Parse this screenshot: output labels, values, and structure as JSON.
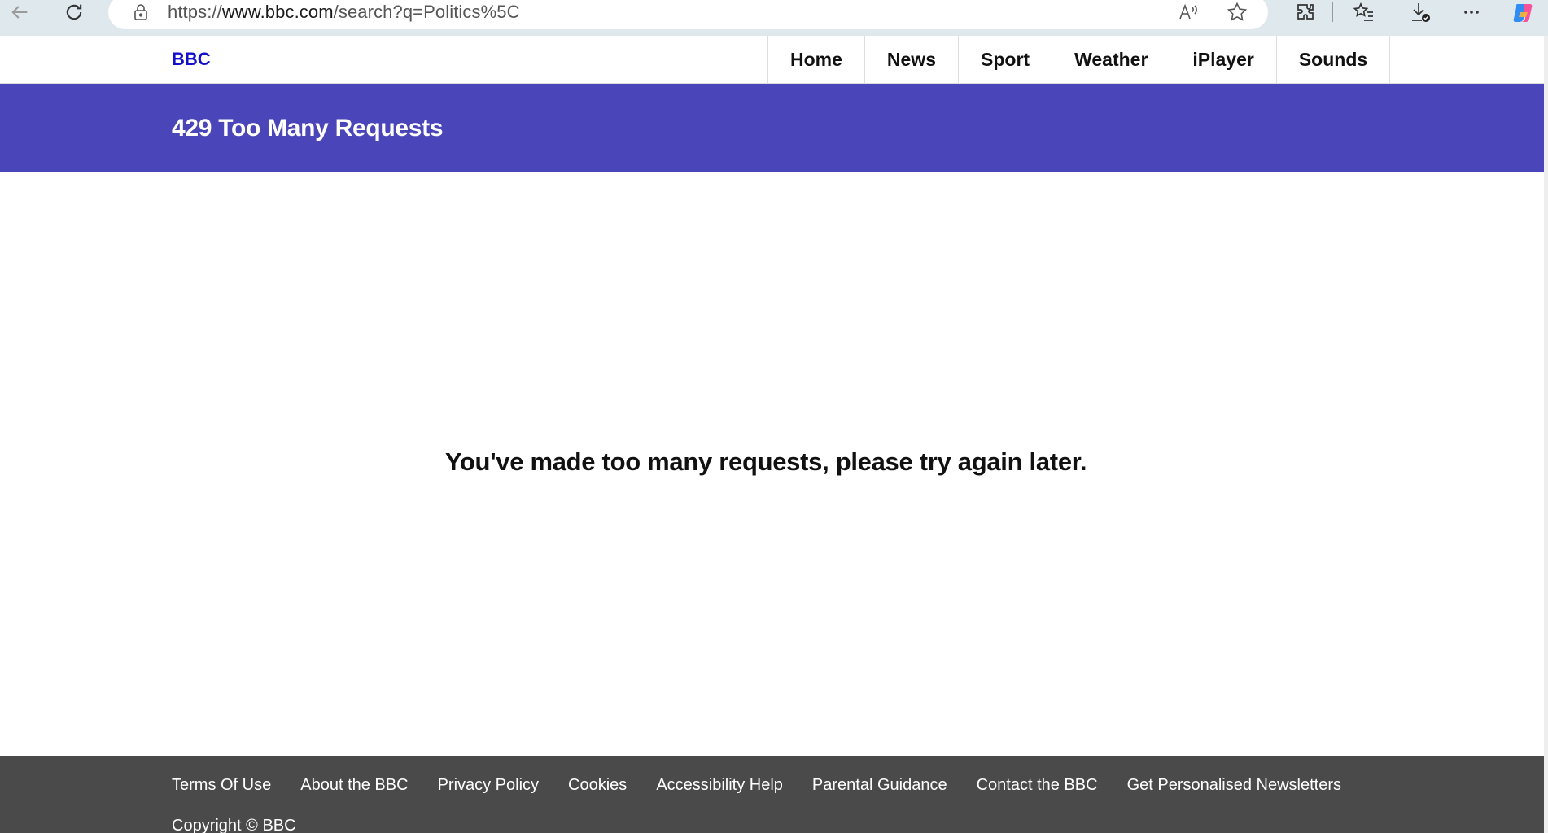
{
  "browser": {
    "url_prefix": "https://",
    "url_host": "www.bbc.com",
    "url_path": "/search?q=Politics%5C",
    "icons": [
      "back-icon",
      "refresh-icon",
      "lock-icon",
      "read-aloud-icon",
      "favorite-star-icon",
      "extensions-icon",
      "favorites-list-icon",
      "downloads-icon",
      "more-icon",
      "copilot-icon"
    ]
  },
  "header": {
    "logo": "BBC",
    "nav": [
      {
        "label": "Home"
      },
      {
        "label": "News"
      },
      {
        "label": "Sport"
      },
      {
        "label": "Weather"
      },
      {
        "label": "iPlayer"
      },
      {
        "label": "Sounds"
      }
    ]
  },
  "banner": {
    "title": "429 Too Many Requests"
  },
  "main": {
    "message": "You've made too many requests, please try again later."
  },
  "footer": {
    "links": [
      {
        "label": "Terms Of Use"
      },
      {
        "label": "About the BBC"
      },
      {
        "label": "Privacy Policy"
      },
      {
        "label": "Cookies"
      },
      {
        "label": "Accessibility Help"
      },
      {
        "label": "Parental Guidance"
      },
      {
        "label": "Contact the BBC"
      },
      {
        "label": "Get Personalised Newsletters"
      }
    ],
    "copyright": "Copyright © BBC"
  },
  "colors": {
    "banner": "#4a45b8",
    "logo": "#1410c9",
    "footer": "#4a4a4a",
    "chrome": "#dfe8ec"
  }
}
